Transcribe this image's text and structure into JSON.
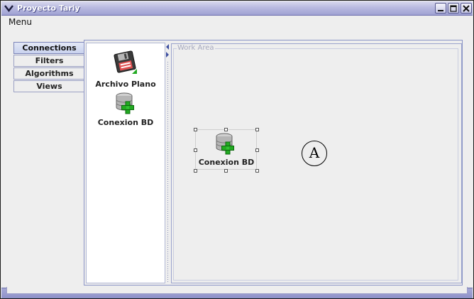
{
  "window": {
    "title": "Proyecto Tariy"
  },
  "menubar": {
    "items": [
      "Menu"
    ]
  },
  "tabs": [
    {
      "label": "Connections",
      "active": true
    },
    {
      "label": "Filters",
      "active": false
    },
    {
      "label": "Algorithms",
      "active": false
    },
    {
      "label": "Views",
      "active": false
    }
  ],
  "palette": {
    "items": [
      {
        "label": "Archivo Plano",
        "icon": "floppy-disk-icon"
      },
      {
        "label": "Conexion BD",
        "icon": "database-add-icon"
      }
    ]
  },
  "workarea": {
    "title": "Work Area",
    "nodes": [
      {
        "label": "Conexion BD",
        "icon": "database-add-icon",
        "selected": true
      }
    ],
    "marker": "A"
  },
  "colors": {
    "titlebar": "#b9bae0",
    "accent": "#8a94c6",
    "icon_green": "#22aa22"
  }
}
